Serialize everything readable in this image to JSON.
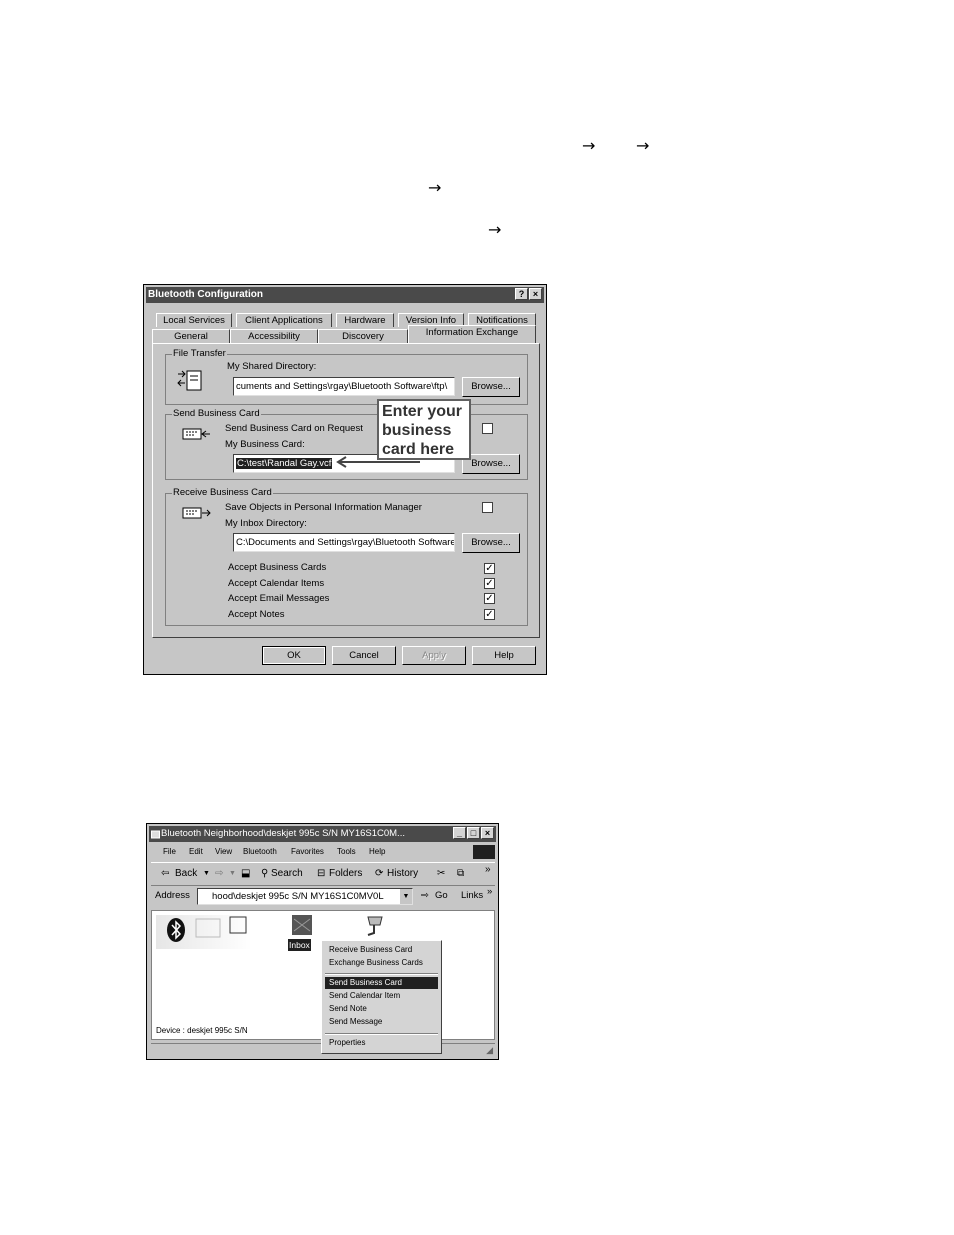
{
  "arrows": [
    "→",
    "→",
    "→",
    "→"
  ],
  "config_dialog": {
    "title": "Bluetooth Configuration",
    "help_button": "?",
    "close_button": "×",
    "tabs_row1": [
      "Local Services",
      "Client Applications",
      "Hardware",
      "Version Info",
      "Notifications"
    ],
    "tabs_row2": [
      "General",
      "Accessibility",
      "Discovery",
      "Information Exchange"
    ],
    "active_tab": "Information Exchange",
    "file_transfer": {
      "group_label": "File Transfer",
      "shared_dir_label": "My Shared Directory:",
      "shared_dir_value": "cuments and Settings\\rgay\\Bluetooth Software\\ftp\\",
      "browse_label": "Browse..."
    },
    "send_card": {
      "group_label": "Send Business Card",
      "on_request_label": "Send Business Card on Request",
      "on_request_checked": false,
      "my_card_label": "My Business Card:",
      "my_card_value": "C:\\test\\Randal Gay.vcf",
      "browse_label": "Browse...",
      "callout": [
        "Enter your",
        "business",
        "card here"
      ]
    },
    "receive_card": {
      "group_label": "Receive Business Card",
      "save_objects_label": "Save Objects in Personal Information Manager",
      "save_objects_checked": false,
      "inbox_label": "My Inbox Directory:",
      "inbox_value": "C:\\Documents and Settings\\rgay\\Bluetooth Software",
      "browse_label": "Browse...",
      "accept_items": [
        {
          "label": "Accept Business Cards",
          "checked": true
        },
        {
          "label": "Accept Calendar Items",
          "checked": true
        },
        {
          "label": "Accept Email Messages",
          "checked": true
        },
        {
          "label": "Accept Notes",
          "checked": true
        }
      ]
    },
    "buttons": {
      "ok": "OK",
      "cancel": "Cancel",
      "apply": "Apply",
      "help": "Help"
    }
  },
  "explorer": {
    "title": "Bluetooth Neighborhood\\deskjet 995c S/N MY16S1C0M...",
    "menu": [
      "File",
      "Edit",
      "View",
      "Bluetooth",
      "Favorites",
      "Tools",
      "Help"
    ],
    "toolbar": {
      "back": "Back",
      "search": "Search",
      "folders": "Folders",
      "history": "History",
      "more": "»"
    },
    "address_label": "Address",
    "address_value": "hood\\deskjet 995c S/N MY16S1C0MV0L",
    "go_label": "Go",
    "links_label": "Links",
    "links_more": "»",
    "inbox_label": "Inbox",
    "device_status": "Device : deskjet 995c S/N",
    "context_menu": {
      "group1": [
        "Receive Business Card",
        "Exchange Business Cards"
      ],
      "group2": [
        "Send Business Card",
        "Send Calendar Item",
        "Send Note",
        "Send Message"
      ],
      "group3": [
        "Properties"
      ],
      "selected": "Send Business Card"
    }
  }
}
